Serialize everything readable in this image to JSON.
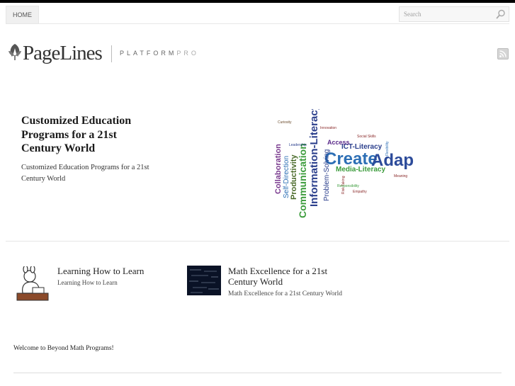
{
  "nav": {
    "home_label": "HOME"
  },
  "search": {
    "placeholder": "Search"
  },
  "logo": {
    "brand": "PageLines",
    "sub_main": "PLATFORM",
    "sub_light": "PRO"
  },
  "icons": {
    "leaf": "leaf-icon",
    "search": "search-icon",
    "rss": "rss-icon"
  },
  "feature": {
    "title": "Customized Education Programs for a 21st Century World",
    "description": "Customized Education Programs for a 21st Century World",
    "wordcloud_words": [
      "Create",
      "Adapt",
      "Information-Literacy",
      "Communication",
      "Collaboration",
      "Productivity",
      "Self-Direction",
      "Problem-Solving",
      "ICT-Literacy",
      "Media-Literacy",
      "Access",
      "Innovation",
      "Social Skills",
      "Curiosity",
      "Leadership",
      "Flexibility",
      "Risk Taking",
      "Responsibility",
      "Meaning",
      "Empathy"
    ]
  },
  "boxes": [
    {
      "title": "Learning How to Learn",
      "description": "Learning How to Learn"
    },
    {
      "title": "Math Excellence for a 21st Century World",
      "description": "Math Excellence for a 21st Century World"
    }
  ],
  "welcome": "Welcome to Beyond Math Programs!",
  "colors": {
    "top_bar": "#000000",
    "text": "#222222"
  }
}
